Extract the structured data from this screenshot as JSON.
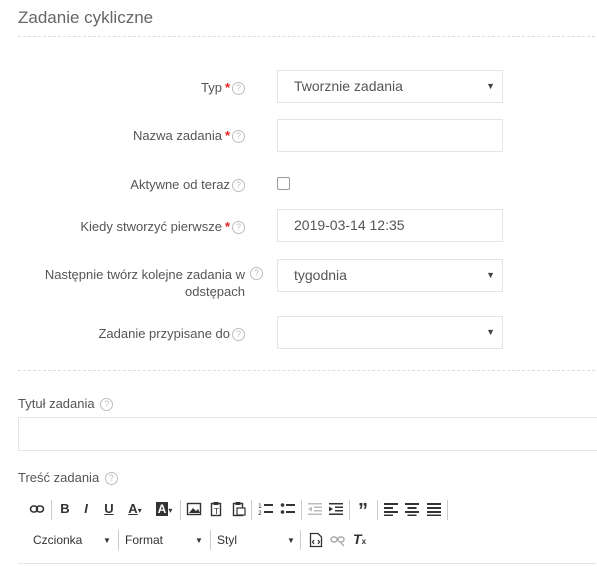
{
  "page_title": "Zadanie cykliczne",
  "help_glyph": "?",
  "required_mark": "*",
  "form": {
    "type_label": "Typ",
    "type_value": "Tworznie zadania",
    "name_label": "Nazwa zadania",
    "name_value": "",
    "active_label": "Aktywne od teraz",
    "active_checked": false,
    "first_label": "Kiedy stworzyć pierwsze",
    "first_value": "2019-03-14 12:35",
    "next_label": "Następnie twórz kolejne zadania w odstępach",
    "next_value": "tygodnia",
    "assigned_label": "Zadanie przypisane do",
    "assigned_value": ""
  },
  "task_title": {
    "label": "Tytuł zadania",
    "value": ""
  },
  "task_content": {
    "label": "Treść zadania"
  },
  "editor_toolbar": {
    "buttons": [
      "link",
      "bold",
      "italic",
      "underline",
      "text-color",
      "background-color",
      "image",
      "paste-text",
      "paste-word",
      "numbered-list",
      "bulleted-list",
      "outdent",
      "indent",
      "blockquote",
      "align-left",
      "align-center",
      "justify"
    ],
    "font_label": "Czcionka",
    "format_label": "Format",
    "style_label": "Styl"
  }
}
